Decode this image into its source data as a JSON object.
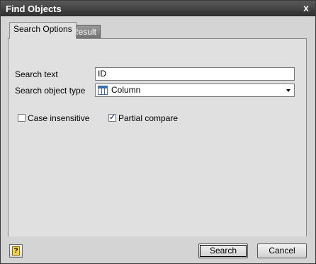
{
  "window": {
    "title": "Find Objects",
    "close_glyph": "x"
  },
  "tabs": [
    {
      "label": "Search Options",
      "active": true
    },
    {
      "label": "Result",
      "active": false
    }
  ],
  "form": {
    "search_text_label": "Search text",
    "search_text_value": "ID",
    "object_type_label": "Search object type",
    "object_type_value": "Column",
    "object_type_icon": "table-column-icon",
    "case_insensitive_label": "Case insensitive",
    "case_insensitive_checked": false,
    "partial_compare_label": "Partial compare",
    "partial_compare_checked": true
  },
  "footer": {
    "help_glyph": "?",
    "search_label": "Search",
    "cancel_label": "Cancel"
  }
}
